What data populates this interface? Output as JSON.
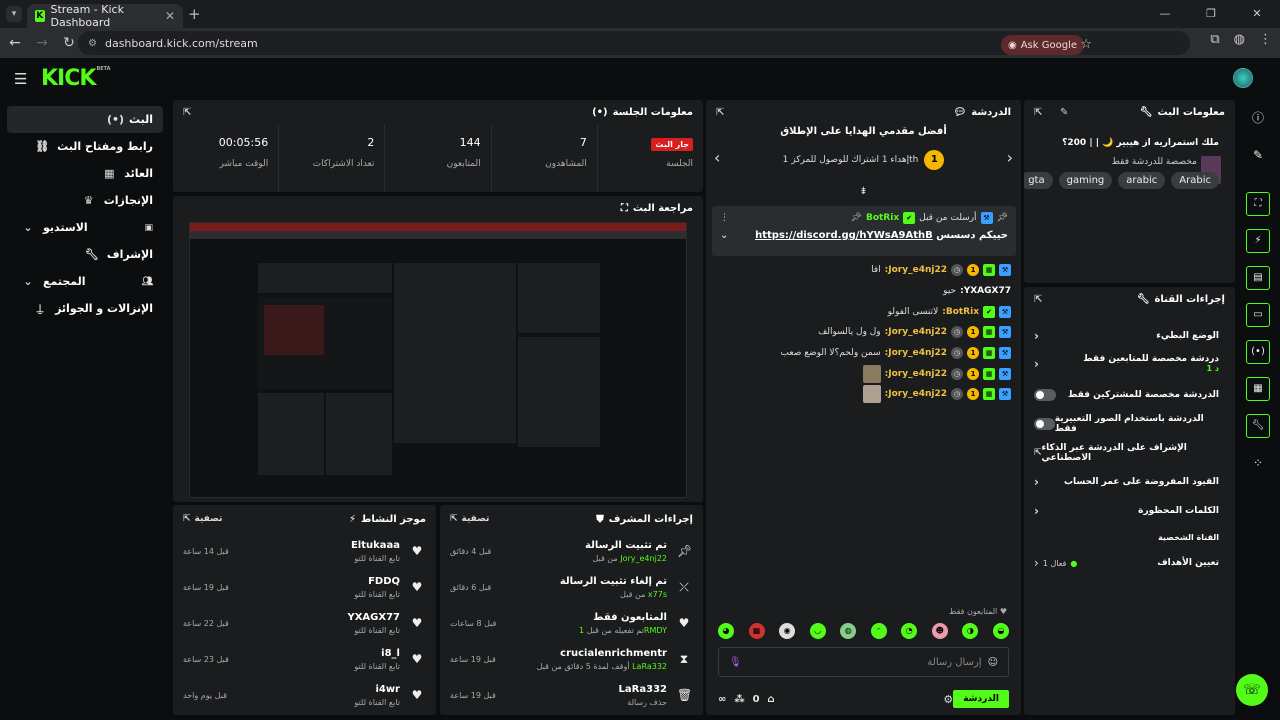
{
  "browser": {
    "tab_title": "Stream - Kick Dashboard",
    "tab_favicon": "K",
    "url": "dashboard.kick.com/stream",
    "ask_google": "Ask Google"
  },
  "brand": {
    "logo": "KICK",
    "logo_sup": "BETA",
    "accent": "#53fc18"
  },
  "sidebar": {
    "items": [
      {
        "label": "البث",
        "icon": "((•))"
      },
      {
        "label": "رابط ومفتاح البث",
        "icon": "🔗"
      },
      {
        "label": "العائد",
        "icon": "▦"
      },
      {
        "label": "الإنجازات",
        "icon": "🏆"
      },
      {
        "label": "الاستديو",
        "icon": "▣"
      },
      {
        "label": "الإشراف",
        "icon": "🔧"
      },
      {
        "label": "المجتمع",
        "icon": "👥"
      },
      {
        "label": "الإنزالات و الجوائز",
        "icon": "⍊"
      }
    ]
  },
  "session": {
    "title": "معلومات الجلسة",
    "live_badge": "جار البث",
    "session_label": "الجلسة",
    "stats": [
      {
        "value": "00:05:56",
        "label": "الوقت مباشر"
      },
      {
        "value": "2",
        "label": "تعداد الاشتراكات"
      },
      {
        "value": "144",
        "label": "المتابعون"
      },
      {
        "value": "7",
        "label": "المشاهدون"
      }
    ]
  },
  "preview": {
    "title": "مراجعة البث"
  },
  "activity": {
    "title": "موجز النشاط",
    "filter": "تصفية",
    "items": [
      {
        "name": "Eltukaaa",
        "sub": "تابع القناة للتو",
        "time": "قبل 14 ساعة"
      },
      {
        "name": "FDDQ",
        "sub": "تابع القناة للتو",
        "time": "قبل 19 ساعة"
      },
      {
        "name": "YXAGX77",
        "sub": "تابع القناة للتو",
        "time": "قبل 22 ساعة"
      },
      {
        "name": "i8_l",
        "sub": "تابع القناة للتو",
        "time": "قبل 23 ساعة"
      },
      {
        "name": "i4wr",
        "sub": "تابع القناة للتو",
        "time": "قبل يوم واحد"
      }
    ]
  },
  "modactions": {
    "title": "إجراءات المشرف",
    "filter": "تصفية",
    "items": [
      {
        "name": "تم تثبيت الرسالة",
        "sub_pre": "من قبل ",
        "sub_user": "Jory_e4nj22",
        "time": "قبل 4 دقائق",
        "icon": "📌"
      },
      {
        "name": "تم إلغاء تثبيت الرسالة",
        "sub_pre": "من قبل ",
        "sub_user": "x77s",
        "time": "قبل 6 دقائق",
        "icon": "⤫"
      },
      {
        "name": "المتابعون فقط",
        "sub_pre": "تم تفعيله من قبل ",
        "sub_user": "1RMDY",
        "time": "قبل 8 ساعات",
        "icon": "♥"
      },
      {
        "name": "crucialenrichmentr",
        "sub_pre": "أوقف لمدة 5 دقائق من قبل ",
        "sub_user": "LaRa332",
        "time": "قبل 19 ساعة",
        "icon": "⧗"
      },
      {
        "name": "LaRa332",
        "sub_pre": "حذف رسالة",
        "sub_user": "",
        "time": "قبل 19 ساعة",
        "icon": "🗑"
      }
    ]
  },
  "chat": {
    "title": "الدردشة",
    "goal_title": "أفضل مقدمي الهدايا على الإطلاق",
    "goal_sub": "إهداء 1 اشتراك للوصول للمركز 1th",
    "goal_rank": "1",
    "pinned_by": "أرسلت من قبل",
    "pinned_user": "BotRix",
    "pinned_text": "حييكم دسسس",
    "pinned_link": "https://discord.gg/hYWsA9AthB",
    "messages": [
      {
        "user": "Jory_e4nj22:",
        "text": "افا",
        "color": "#f0c040"
      },
      {
        "user": "YXAGX77:",
        "text": "حيو",
        "color": "#ffffff"
      },
      {
        "user": "BotRix:",
        "text": "لاتنسى الفولو",
        "color": "#f0c040"
      },
      {
        "user": "Jory_e4nj22:",
        "text": "ول ول يالسوالف",
        "color": "#f0c040"
      },
      {
        "user": "Jory_e4nj22:",
        "text": "سمن ولحم؟لا الوضع صعب",
        "color": "#f0c040"
      },
      {
        "user": "Jory_e4nj22:",
        "text": "",
        "color": "#f0c040"
      },
      {
        "user": "Jory_e4nj22:",
        "text": "",
        "color": "#f0c040"
      }
    ],
    "followers_only": "المتابعون فقط",
    "input_placeholder": "إرسال رسالة",
    "send_label": "الدردشة",
    "viewer_count": "0"
  },
  "stream_info": {
    "title": "معلومات البث",
    "stream_title": "ملك استمراريه از هيبير 🌙 | | 200؟",
    "category": "مخصصة للدردشة فقط",
    "tags": [
      "Arabic",
      "arabic",
      "gaming",
      "gta"
    ]
  },
  "channel_actions": {
    "title": "إجراءات القناة",
    "items": [
      {
        "label": "الوضع البطيء",
        "sub": "",
        "type": "chevron"
      },
      {
        "label": "دردشة مخصصة للمتابعين فقط",
        "sub": "1 د",
        "type": "chevron"
      },
      {
        "label": "الدردشة مخصصة للمشتركين فقط",
        "sub": "",
        "type": "toggle"
      },
      {
        "label": "الدردشة باستخدام الصور التعبيرية فقط",
        "sub": "",
        "type": "toggle"
      },
      {
        "label": "الإشراف على الدردشة عبر الذكاء الاصطناعي",
        "sub": "",
        "type": "external"
      },
      {
        "label": "القيود المفروضة على عمر الحساب",
        "sub": "",
        "type": "chevron"
      },
      {
        "label": "الكلمات المحظورة",
        "sub": "",
        "type": "chevron"
      }
    ],
    "section_label": "القناة الشخصية",
    "goals_label": "تعيين الأهداف",
    "goals_status": "فعال 1"
  }
}
